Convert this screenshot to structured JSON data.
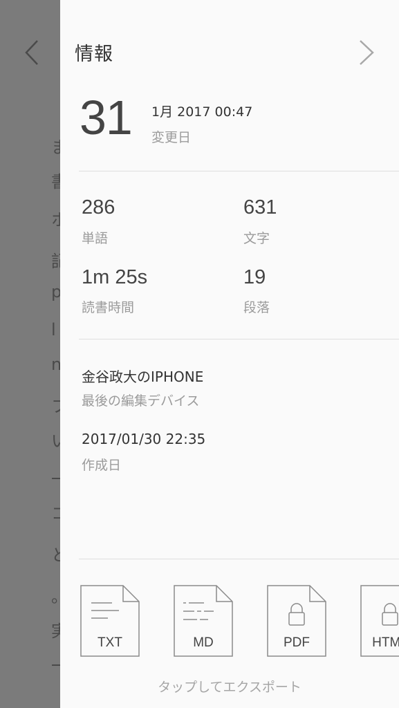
{
  "background": {
    "visible_chars": [
      "ま",
      "書",
      "ホ",
      "記",
      "p",
      "l",
      "n",
      "フ",
      "い",
      "一",
      "コ",
      "と",
      "。",
      "実",
      "一"
    ]
  },
  "info": {
    "title": "情報",
    "modified": {
      "day": "31",
      "date": "1月 2017 00:47",
      "label": "変更日"
    },
    "stats": [
      {
        "value": "286",
        "label": "単語"
      },
      {
        "value": "631",
        "label": "文字"
      },
      {
        "value": "1m 25s",
        "label": "読書時間"
      },
      {
        "value": "19",
        "label": "段落"
      }
    ],
    "device": {
      "name": "金谷政大のIPHONE",
      "label": "最後の編集デバイス"
    },
    "created": {
      "date": "2017/01/30 22:35",
      "label": "作成日"
    }
  },
  "export": {
    "formats": [
      {
        "label": "TXT",
        "icon": "text-file-icon"
      },
      {
        "label": "MD",
        "icon": "markdown-file-icon"
      },
      {
        "label": "PDF",
        "icon": "locked-file-icon"
      },
      {
        "label": "HTML",
        "icon": "locked-file-icon"
      }
    ],
    "hint": "タップしてエクスポート"
  },
  "colors": {
    "panel_bg": "#fafafa",
    "overlay": "#7a7a7a",
    "text": "#333333",
    "label": "#9b9b9b"
  }
}
